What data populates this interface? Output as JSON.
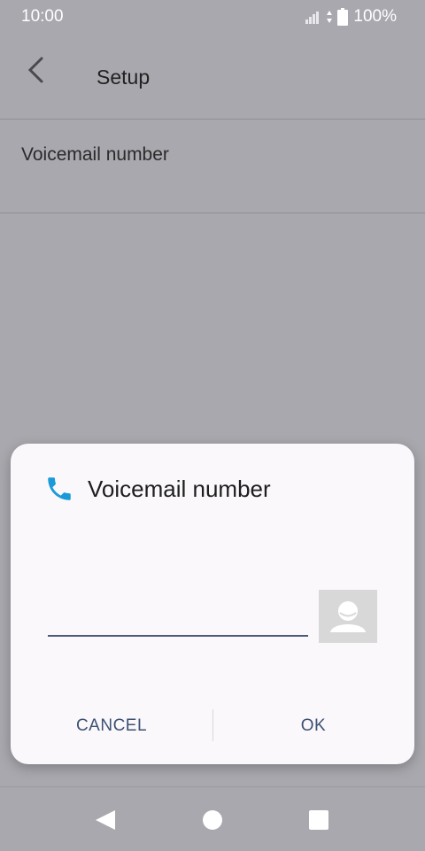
{
  "status_bar": {
    "time": "10:00",
    "battery": "100%"
  },
  "app_bar": {
    "title": "Setup"
  },
  "settings": {
    "item_label": "Voicemail number"
  },
  "dialog": {
    "title": "Voicemail number",
    "input_value": "",
    "cancel_label": "CANCEL",
    "ok_label": "OK"
  },
  "icons": {
    "back": "back-arrow-icon",
    "phone": "phone-icon",
    "contact": "contact-icon",
    "nav_back": "nav-back-icon",
    "nav_home": "nav-home-icon",
    "nav_recents": "nav-recents-icon"
  },
  "colors": {
    "accent": "#1a9bd7",
    "button_text": "#3d5173"
  }
}
